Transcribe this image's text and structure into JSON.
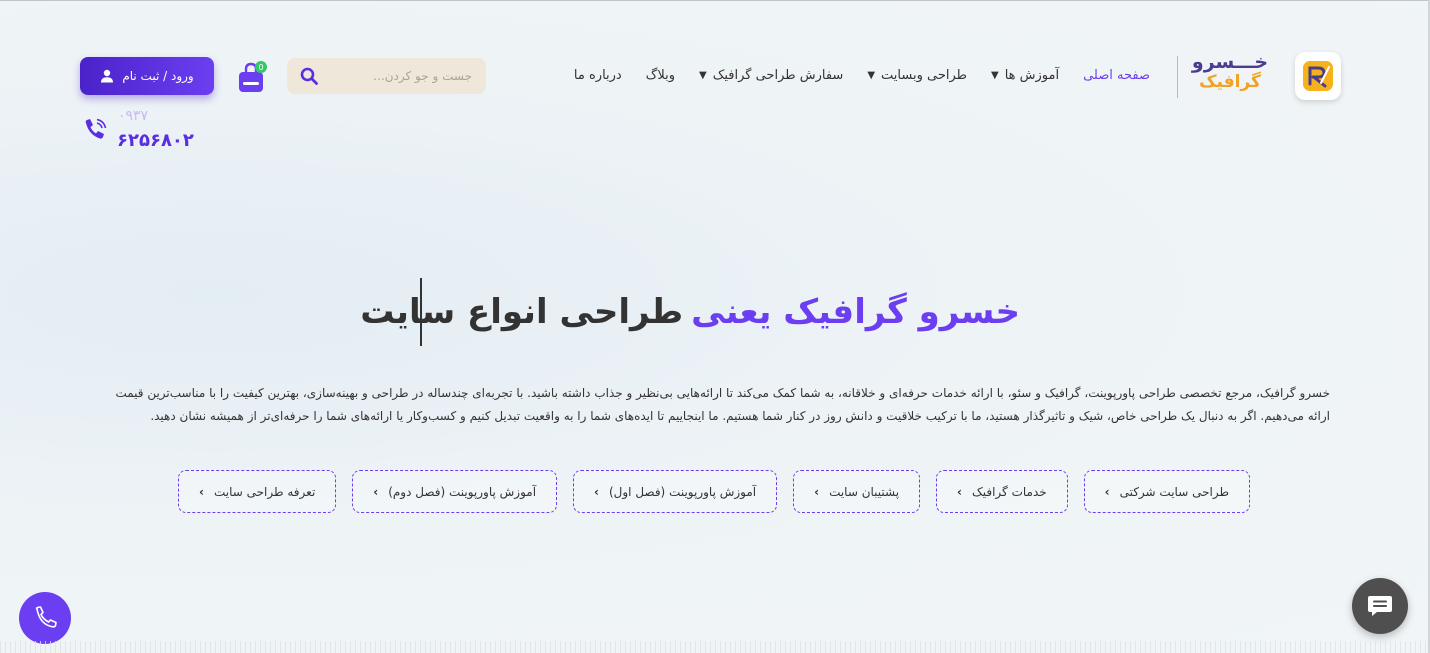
{
  "header": {
    "logo": {
      "line1": "خـــسرو",
      "line2": "گرافیک"
    },
    "nav": [
      {
        "label": "صفحه اصلی",
        "dropdown": false,
        "active": true
      },
      {
        "label": "آموزش ها",
        "dropdown": true,
        "active": false
      },
      {
        "label": "طراحی وبسایت",
        "dropdown": true,
        "active": false
      },
      {
        "label": "سفارش طراحی گرافیک",
        "dropdown": true,
        "active": false
      },
      {
        "label": "وبلاگ",
        "dropdown": false,
        "active": false
      },
      {
        "label": "درباره ما",
        "dropdown": false,
        "active": false
      }
    ],
    "search": {
      "placeholder": "جست و جو کردن..."
    },
    "cart": {
      "count": "0"
    },
    "login": {
      "label": "ورود / ثبت نام"
    },
    "phone": {
      "prefix": "۰۹۳۷",
      "number": "۶۲۵۶۸۰۲"
    }
  },
  "hero": {
    "highlight": "خسرو گرافیک یعنی",
    "rest": "طراحی انواع سایت"
  },
  "description": "خسرو گرافیک، مرجع تخصصی طراحی پاورپوینت، گرافیک و سئو، با ارائه خدمات حرفه‌ای و خلاقانه، به شما کمک می‌کند تا ارائه‌هایی بی‌نظیر و جذاب داشته باشید. با تجربه‌ای چندساله در طراحی و بهینه‌سازی، بهترین کیفیت را با مناسب‌ترین قیمت ارائه می‌دهیم. اگر به دنبال یک طراحی خاص، شیک و تاثیرگذار هستید، ما با ترکیب خلاقیت و دانش روز در کنار شما هستیم. ما اینجاییم تا ایده‌های شما را به واقعیت تبدیل کنیم و کسب‌وکار یا ارائه‌های شما را حرفه‌ای‌تر از همیشه نشان دهید.",
  "chips": [
    {
      "label": "طراحی سایت شرکتی",
      "chevron": "›"
    },
    {
      "label": "خدمات گرافیک",
      "chevron": "›"
    },
    {
      "label": "پشتیبان سایت",
      "chevron": "›"
    },
    {
      "label": "آموزش پاورپوینت (فصل اول)",
      "chevron": "›"
    },
    {
      "label": "آموزش پاورپوینت (فصل دوم)",
      "chevron": "›"
    },
    {
      "label": "تعرفه طراحی سایت",
      "chevron": "›"
    }
  ],
  "colors": {
    "accent": "#6b3ff1",
    "brand_orange": "#f0a224",
    "badge_green": "#37c46b",
    "chat_fab": "#4f4f4f"
  },
  "icons": {
    "logo": "logo-icon",
    "search": "search-icon",
    "cart": "shopping-bag-icon",
    "login": "user-icon",
    "phone": "phone-icon",
    "call_fab": "phone-icon",
    "chat_fab": "chat-icon"
  }
}
